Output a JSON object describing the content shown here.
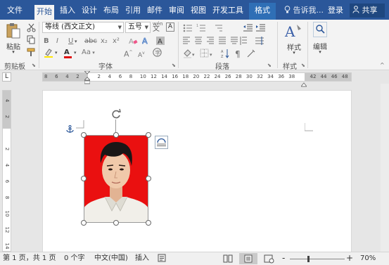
{
  "menu": {
    "tabs": [
      "文件",
      "开始",
      "插入",
      "设计",
      "布局",
      "引用",
      "邮件",
      "审阅",
      "视图",
      "开发工具",
      "格式"
    ],
    "active": "开始",
    "tell_me": "告诉我...",
    "login": "登录",
    "share": "共享"
  },
  "ribbon": {
    "clipboard": {
      "paste": "粘贴",
      "label": "剪贴板"
    },
    "font": {
      "name": "等线 (西文正文)",
      "size": "五号",
      "label": "字体",
      "wen_label": "wén",
      "case_label": "Aa",
      "chr_box": "A",
      "bold": "B",
      "italic": "I",
      "underline": "U",
      "strike": "abc",
      "sub": "x₂",
      "sup": "x²",
      "color_a": "A",
      "grow": "A",
      "shrink": "A"
    },
    "paragraph": {
      "label": "段落"
    },
    "styles": {
      "label": "样式",
      "button": "样式"
    },
    "editing": {
      "button": "编辑"
    }
  },
  "ruler": {
    "corner": "L",
    "h_ticks": [
      "8",
      "6",
      "4",
      "2",
      "",
      "2",
      "4",
      "6",
      "8",
      "10",
      "12",
      "14",
      "16",
      "18",
      "20",
      "22",
      "24",
      "26",
      "28",
      "30",
      "32",
      "34",
      "36",
      "38",
      "",
      "42",
      "44",
      "46",
      "48"
    ],
    "v_ticks": [
      "4",
      "2",
      "",
      "2",
      "4",
      "6",
      "8",
      "10",
      "12",
      "14"
    ]
  },
  "status": {
    "page": "第 1 页，共 1 页",
    "words": "0 个字",
    "lang": "中文(中国)",
    "mode": "插入",
    "zoom_minus": "-",
    "zoom_plus": "+",
    "zoom": "70%"
  },
  "colors": {
    "titlebar": "#2b579a",
    "photo_bg": "#ea1010",
    "font_color_bar": "#e01010",
    "highlight_bar": "#ffe600"
  }
}
